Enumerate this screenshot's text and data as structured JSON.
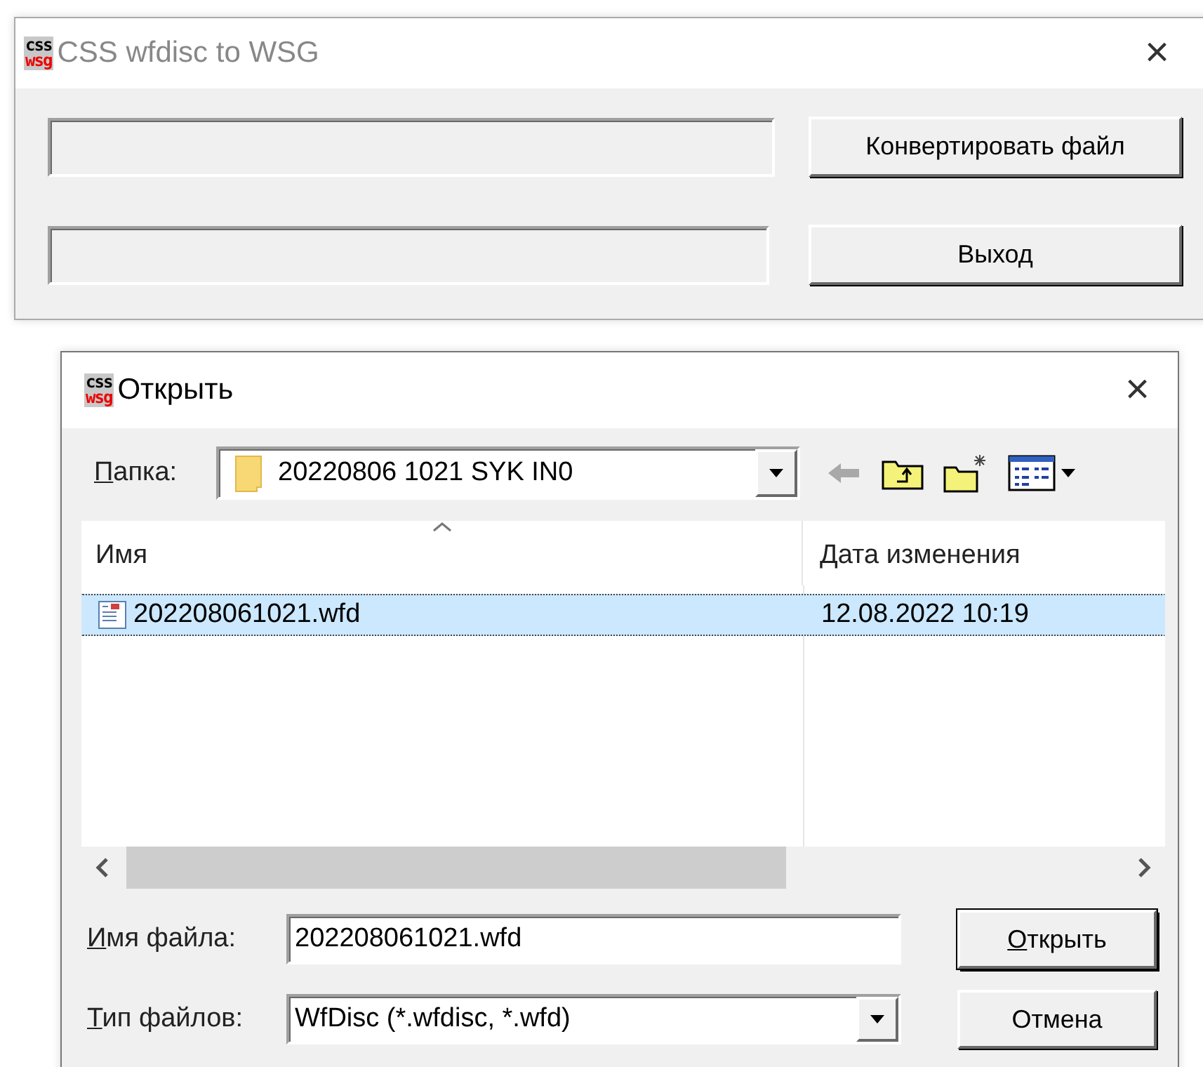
{
  "main_window": {
    "logo": {
      "top": "css",
      "bottom": "wsg"
    },
    "title": "CSS wfdisc to WSG",
    "close": "×",
    "buttons": [
      "Конвертировать файл",
      "Выход"
    ]
  },
  "open_dialog": {
    "logo": {
      "top": "css",
      "bottom": "wsg"
    },
    "title": "Открыть",
    "close": "×",
    "folder": {
      "label": "Папка:",
      "underline_first": true,
      "value": "20220806 1021 SYK IN0"
    },
    "columns": [
      {
        "label": "Имя",
        "sorted": true
      },
      {
        "label": "Дата изменения",
        "sorted": false
      }
    ],
    "files": [
      {
        "name": "202208061021.wfd",
        "date": "12.08.2022 10:19",
        "selected": true
      }
    ],
    "file_name": {
      "label": "Имя файла:",
      "underline_first": true,
      "value": "202208061021.wfd"
    },
    "file_type": {
      "label": "Тип файлов:",
      "underline_first": true,
      "value": "WfDisc (*.wfdisc, *.wfd)"
    },
    "buttons": [
      {
        "label": "Открыть",
        "underline_first": true,
        "default": true
      },
      {
        "label": "Отмена",
        "underline_first": false,
        "default": false
      }
    ]
  }
}
